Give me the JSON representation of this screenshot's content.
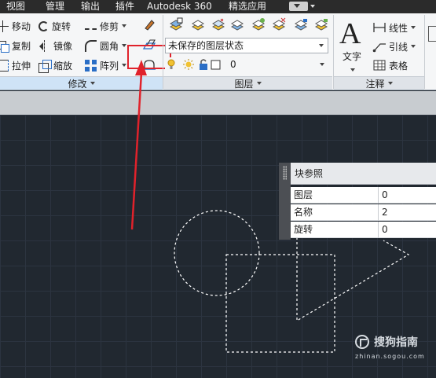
{
  "menubar": {
    "items": [
      "视图",
      "管理",
      "输出",
      "插件",
      "Autodesk 360",
      "精选应用"
    ]
  },
  "ribbon": {
    "modify": {
      "tools": [
        "移动",
        "旋转",
        "修剪",
        "复制",
        "镜像",
        "圆角",
        "拉伸",
        "缩放",
        "阵列"
      ],
      "panel_label": "修改"
    },
    "layers": {
      "layer_state": "未保存的图层状态",
      "current_layer": "0",
      "panel_label": "图层"
    },
    "annotation": {
      "big_text_label": "文字",
      "tools": [
        "线性",
        "引线",
        "表格"
      ],
      "panel_label": "注释"
    }
  },
  "properties": {
    "title": "块参照",
    "rows": [
      {
        "key": "图层",
        "value": "0"
      },
      {
        "key": "名称",
        "value": "2"
      },
      {
        "key": "旋转",
        "value": "0"
      }
    ]
  },
  "watermark": {
    "name": "搜狗指南",
    "url": "zhinan.sogou.com"
  },
  "colors": {
    "canvas": "#212830",
    "highlight": "#e0222b",
    "selection": "#ffffff"
  }
}
